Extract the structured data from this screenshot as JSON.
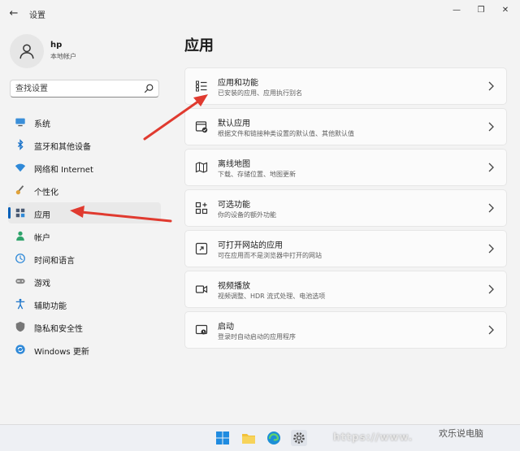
{
  "window": {
    "title": "设置",
    "back_icon": "back-arrow-icon",
    "controls": [
      "minimize-icon",
      "maximize-icon",
      "close-icon"
    ]
  },
  "profile": {
    "name": "hp",
    "account_type": "本地帐户"
  },
  "search": {
    "placeholder": "查找设置"
  },
  "sidebar": {
    "items": [
      {
        "label": "系统",
        "icon": "monitor-icon"
      },
      {
        "label": "蓝牙和其他设备",
        "icon": "bluetooth-icon"
      },
      {
        "label": "网络和 Internet",
        "icon": "wifi-icon"
      },
      {
        "label": "个性化",
        "icon": "brush-icon"
      },
      {
        "label": "应用",
        "icon": "apps-icon",
        "active": true
      },
      {
        "label": "帐户",
        "icon": "person-icon"
      },
      {
        "label": "时间和语言",
        "icon": "globe-clock-icon"
      },
      {
        "label": "游戏",
        "icon": "gamepad-icon"
      },
      {
        "label": "辅助功能",
        "icon": "accessibility-icon"
      },
      {
        "label": "隐私和安全性",
        "icon": "shield-icon"
      },
      {
        "label": "Windows 更新",
        "icon": "update-icon"
      }
    ]
  },
  "main": {
    "title": "应用",
    "cards": [
      {
        "title": "应用和功能",
        "subtitle": "已安装的应用、应用执行别名",
        "icon": "list-icon"
      },
      {
        "title": "默认应用",
        "subtitle": "根据文件和链接种类设置的默认值、其他默认值",
        "icon": "default-apps-icon"
      },
      {
        "title": "离线地图",
        "subtitle": "下载、存储位置、地图更新",
        "icon": "map-icon"
      },
      {
        "title": "可选功能",
        "subtitle": "你的设备的额外功能",
        "icon": "grid-plus-icon"
      },
      {
        "title": "可打开网站的应用",
        "subtitle": "可在应用而不是浏览器中打开的网站",
        "icon": "open-link-icon"
      },
      {
        "title": "视频播放",
        "subtitle": "视频调整、HDR 流式处理、电池选项",
        "icon": "video-icon"
      },
      {
        "title": "启动",
        "subtitle": "登录时自动启动的应用程序",
        "icon": "startup-icon"
      }
    ]
  },
  "colors": {
    "accent": "#005fb8",
    "annotation_arrow": "#e03a2f"
  },
  "taskbar": {
    "icons": [
      "windows-start-icon",
      "file-explorer-icon",
      "edge-icon",
      "settings-icon"
    ],
    "url_watermark": "https://www.",
    "watermark": "欢乐说电脑"
  }
}
